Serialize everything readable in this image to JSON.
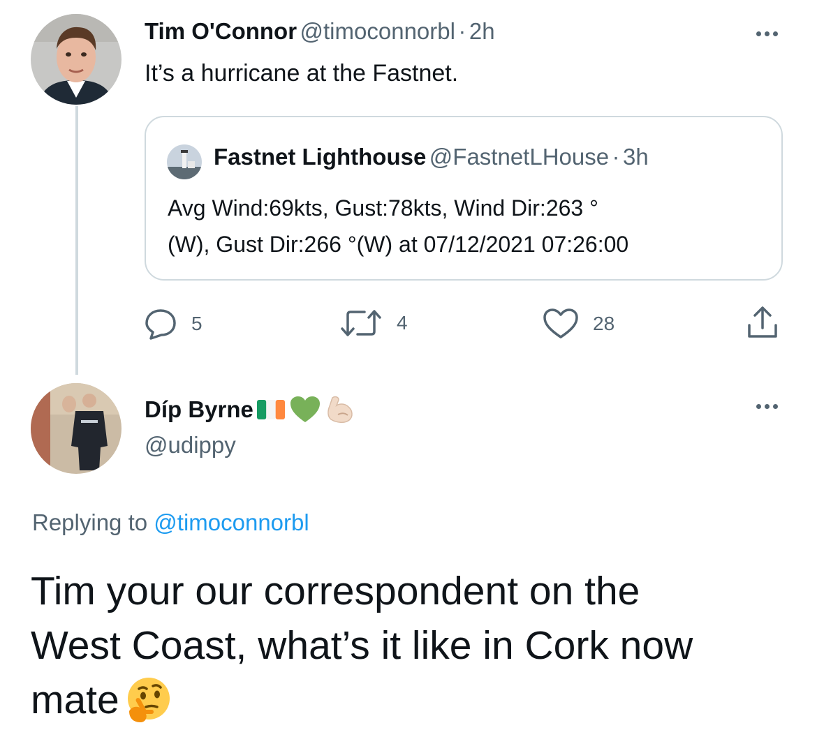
{
  "tweet": {
    "author_name": "Tim O'Connor",
    "author_handle": "@timoconnorbl",
    "separator": "·",
    "time": "2h",
    "text": "It’s a hurricane at the Fastnet.",
    "quote": {
      "author_name": "Fastnet Lighthouse",
      "author_handle": "@FastnetLHouse",
      "separator": "·",
      "time": "3h",
      "text_line1": "Avg Wind:69kts, Gust:78kts, Wind Dir:263 °",
      "text_line2": "(W), Gust Dir:266 °(W) at 07/12/2021 07:26:00"
    },
    "actions": {
      "replies": "5",
      "retweets": "4",
      "likes": "28"
    }
  },
  "reply": {
    "author_name": "Díp Byrne",
    "author_handle": "@udippy",
    "replying_prefix": "Replying to",
    "replying_to": "@timoconnorbl",
    "text_line1": "Tim your our correspondent on the",
    "text_line2": "West Coast, what’s it like in Cork now",
    "text_line3": "mate"
  },
  "icons": {
    "reply": "reply-bubble-icon",
    "retweet": "retweet-icon",
    "like": "heart-icon",
    "share": "share-icon",
    "more": "more-dots-icon",
    "flag": "ireland-flag-emoji",
    "green_heart": "green-heart-emoji",
    "flexed_biceps": "flexed-biceps-emoji",
    "thinking": "thinking-face-emoji"
  },
  "colors": {
    "text": "#0f1419",
    "muted": "#536471",
    "link": "#1d9bf0",
    "border": "#cfd9de",
    "flag_green": "#169b62",
    "flag_orange": "#ff883e",
    "heart_green": "#78b159"
  }
}
